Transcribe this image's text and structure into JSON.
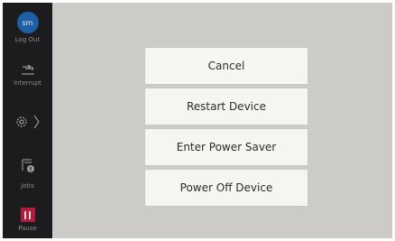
{
  "sidebar": {
    "avatar_initials": "sm",
    "logout_label": "Log Out",
    "interrupt_label": "Interrupt",
    "jobs_label": "Jobs",
    "pause_label": "Pause",
    "icons": [
      "interrupt-icon",
      "settings-gear-icon",
      "chevron-right-icon",
      "jobs-printer-icon",
      "pause-icon"
    ]
  },
  "menu": {
    "cancel": "Cancel",
    "restart": "Restart Device",
    "power_saver": "Enter Power Saver",
    "power_off": "Power Off Device"
  },
  "colors": {
    "sidebar_bg": "#1c1c1e",
    "content_bg": "#cdcbc8",
    "avatar": "#1f5fa5",
    "pause": "#b01c3c",
    "button_bg": "#f7f5f2"
  }
}
